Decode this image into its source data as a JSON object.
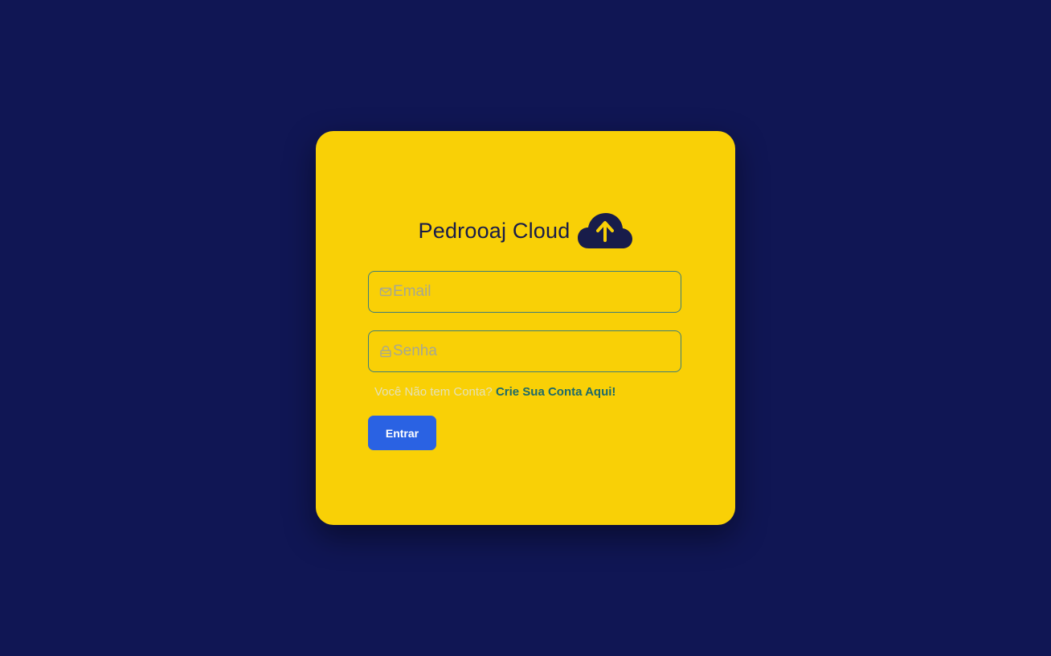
{
  "brand": {
    "title": "Pedrooaj Cloud",
    "icon": "cloud-upload-icon"
  },
  "form": {
    "email_placeholder": "Email",
    "email_icon": "mail-icon",
    "password_placeholder": "Senha",
    "password_icon": "lock-icon",
    "signup_question": "Você Não tem Conta?",
    "signup_link": "Crie Sua Conta Aqui!",
    "submit_label": "Entrar"
  },
  "colors": {
    "background": "#101654",
    "card": "#f9d006",
    "title": "#181c4a",
    "field_border": "#3f7d79",
    "link": "#1d6a6a",
    "button": "#2a62e3"
  }
}
